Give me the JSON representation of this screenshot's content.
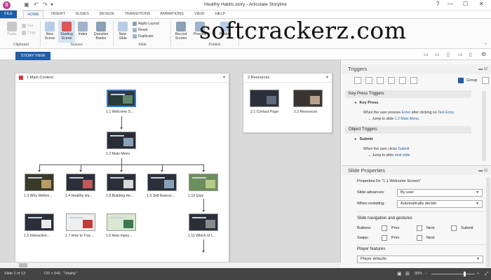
{
  "window": {
    "title": "Healthy Habits.story - Articulate Storyline",
    "app_logo": "S"
  },
  "tabs": [
    "FILE",
    "HOME",
    "INSERT",
    "SLIDES",
    "DESIGN",
    "TRANSITIONS",
    "ANIMATIONS",
    "VIEW",
    "HELP"
  ],
  "active_tab": "HOME",
  "ribbon": {
    "paste": "Paste",
    "cut": "Cut",
    "copy": "Copy",
    "clipboard_group": "Clipboard",
    "new_scene": "New Scene",
    "starting_scene": "Starting Scene",
    "index": "Index",
    "question_banks": "Question Banks",
    "scenes_group": "Scenes",
    "new_slide": "New Slide",
    "apply_layout": "Apply Layout",
    "reset": "Reset",
    "duplicate": "Duplicate",
    "slide_group": "Slide",
    "record_screen": "Record Screen",
    "preview": "Preview",
    "publish": "Publish",
    "publish_group": "Publish"
  },
  "watermark": "softcrackerz.com",
  "story_view_tab": "STORY VIEW",
  "scenes": {
    "main": {
      "title": "1 Main Content",
      "slides": [
        {
          "label": "1.1 Welcome S..."
        },
        {
          "label": "1.2 Main Menu"
        },
        {
          "label": "1.3 Why Wellne..."
        },
        {
          "label": "1.4 Healthy Ha..."
        },
        {
          "label": "1.8 Building He..."
        },
        {
          "label": "1.9 Self Assess..."
        },
        {
          "label": "1.10 Quiz"
        },
        {
          "label": "1.5 Interactive..."
        },
        {
          "label": "1.7 How to Trac..."
        },
        {
          "label": "1.6 How many..."
        },
        {
          "label": "1.11 Which of t..."
        }
      ]
    },
    "resources": {
      "title": "2 Resources",
      "slides": [
        {
          "label": "2.1 Contact Page"
        },
        {
          "label": "2.2 Resources"
        }
      ]
    }
  },
  "triggers": {
    "title": "Triggers",
    "group_label": "Group",
    "key_press": {
      "section": "Key Press Triggers",
      "item": "Key Press",
      "line1_a": "When the user presses ",
      "line1_b": "Enter",
      "line1_c": " after clicking on ",
      "line1_d": "Text Entry",
      "line2_a": "Jump to slide ",
      "line2_b": "1.2 Main Menu"
    },
    "object": {
      "section": "Object Triggers",
      "item": "Submit",
      "line1_a": "When the user clicks ",
      "line1_b": "Submit",
      "line2_a": "Jump to slide ",
      "line2_b": "next slide"
    }
  },
  "slide_properties": {
    "title": "Slide Properties",
    "properties_for": "Properties for \"1.1 Welcome Screen\"",
    "slide_advances_label": "Slide advances:",
    "slide_advances_value": "By user",
    "when_revisiting_label": "When revisiting:",
    "when_revisiting_value": "Automatically decide",
    "nav_section": "Slide navigation and gestures",
    "buttons_label": "Buttons:",
    "swipe_label": "Swipe:",
    "prev": "Prev",
    "next": "Next",
    "submit": "Submit",
    "player_features": "Player features",
    "player_value": "Player defaults"
  },
  "status": {
    "slide": "Slide 1 of 13",
    "size": "720 × 540",
    "theme": "\"Vitality\"",
    "zoom": "90%"
  },
  "colors": {
    "accent": "#1f5ea8",
    "brand": "#c13a8f"
  }
}
